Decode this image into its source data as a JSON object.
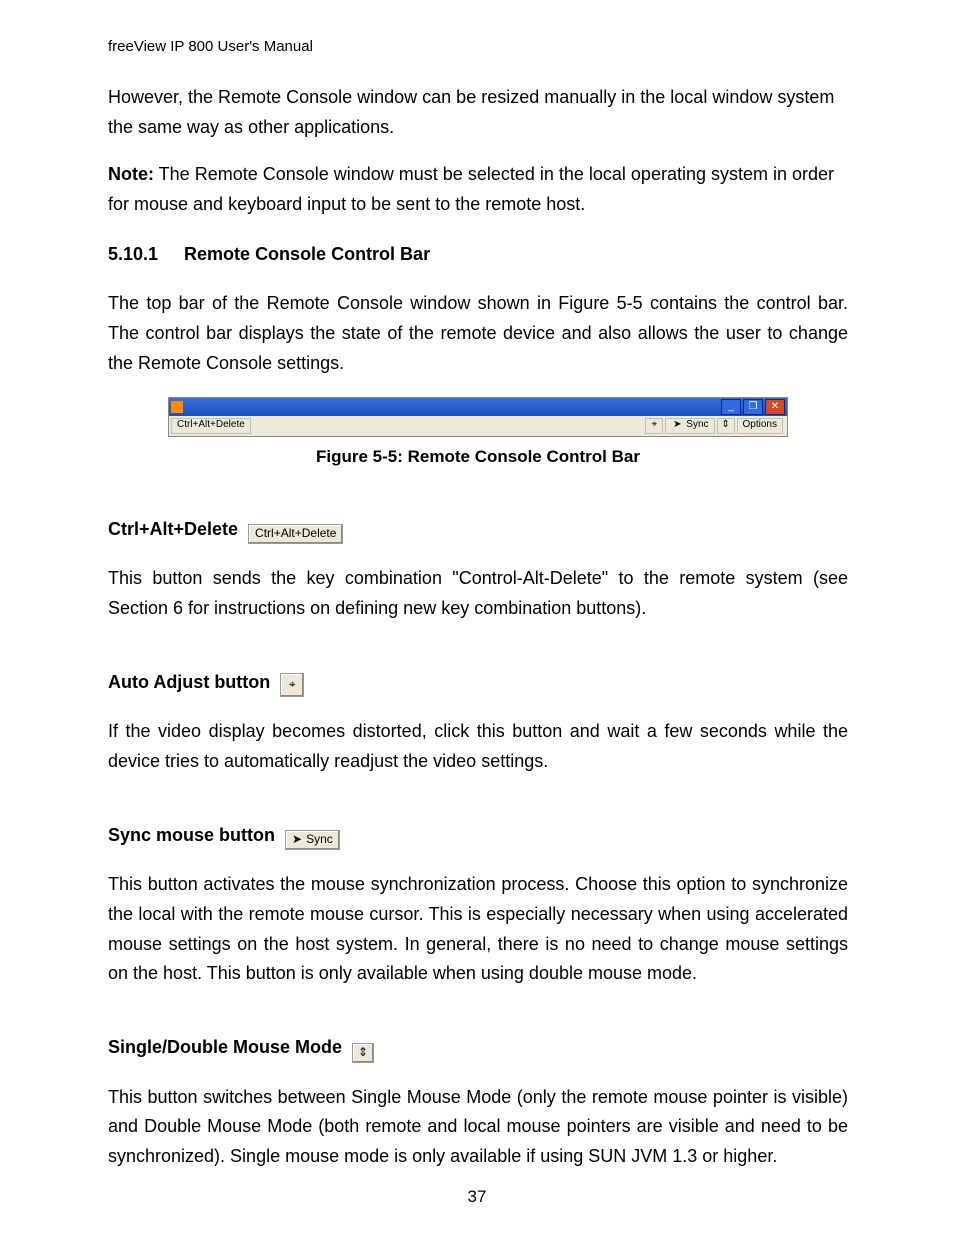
{
  "header": {
    "running_title": "freeView IP 800 User's Manual"
  },
  "page": {
    "number": "37"
  },
  "paragraphs": {
    "intro1": "However, the Remote Console window can be resized manually in the local window system the same way as other applications.",
    "note_label": "Note:",
    "note_text": " The Remote Console window must be selected in the local operating system in order for mouse and keyboard input to be sent to the remote host.",
    "section_num": "5.10.1",
    "section_title": "Remote Console Control Bar",
    "section_body": "The top bar of the Remote Console window shown in Figure 5-5 contains the control bar. The control bar displays the state of the remote device and also allows the user to change the Remote Console settings.",
    "figure_caption": "Figure 5-5: Remote Console Control Bar"
  },
  "console_bar": {
    "ctrl_alt_delete": "Ctrl+Alt+Delete",
    "sync": "Sync",
    "options": "Options",
    "min_glyph": "_",
    "max_glyph": "❐",
    "close_glyph": "✕",
    "adjust_glyph": "⌖",
    "cursor_glyph": "➤",
    "mouse_mode_glyph": "⇕"
  },
  "items": {
    "ctrl_alt_delete": {
      "label": "Ctrl+Alt+Delete",
      "btn_text": "Ctrl+Alt+Delete",
      "desc": "This button sends the key combination \"Control-Alt-Delete\" to the remote system (see Section 6 for instructions on defining new key combination buttons)."
    },
    "auto_adjust": {
      "label": "Auto Adjust button",
      "glyph": "⌖",
      "desc": "If the video display becomes distorted, click this button and wait a few seconds while the device tries to automatically readjust the video settings."
    },
    "sync_mouse": {
      "label": "Sync mouse button",
      "btn_text": "Sync",
      "cursor_glyph": "➤",
      "desc": "This button activates the mouse synchronization process. Choose this option to synchronize the local with the remote mouse cursor. This is especially necessary when using accelerated mouse settings on the host system. In general, there is no need to change mouse settings on the host. This button is only available when using double mouse mode."
    },
    "mouse_mode": {
      "label": "Single/Double Mouse Mode",
      "glyph": "⇕",
      "desc": "This button switches between Single Mouse Mode (only the remote mouse pointer is visible) and Double Mouse Mode (both remote and local mouse pointers are visible and need to be synchronized). Single mouse mode is only available if using SUN JVM 1.3 or higher."
    }
  }
}
